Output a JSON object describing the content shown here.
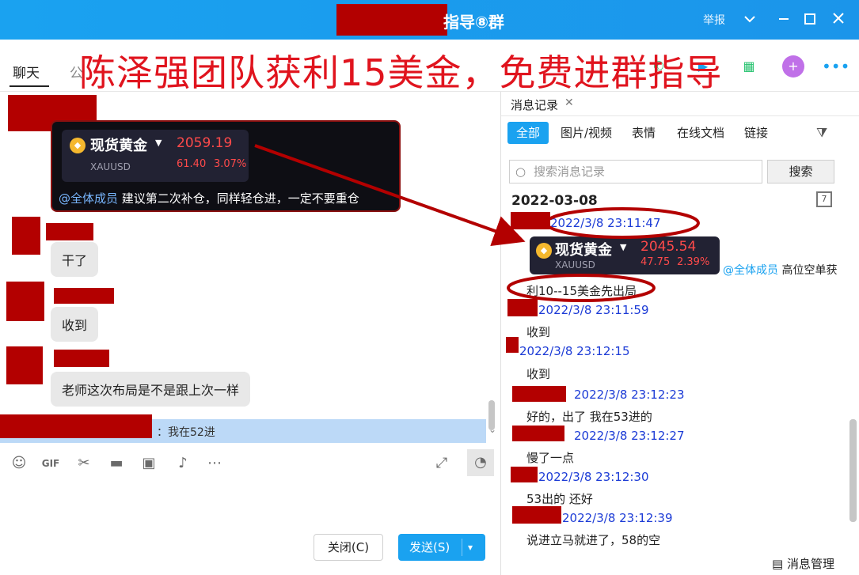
{
  "window": {
    "title": "指导⑧群",
    "report": "举报"
  },
  "banner": "陈泽强团队获利15美金，免费进群指导",
  "tabs": [
    {
      "label": "聊天"
    },
    {
      "label": "公"
    }
  ],
  "chat": {
    "quote": {
      "name": "现货黄金",
      "price": "2059.19",
      "code": "XAUUSD",
      "change": "61.40",
      "change_pct": "3.07%"
    },
    "announcement_mention": "@全体成员",
    "announcement_text": " 建议第二次补仓，同样轻仓进，一定不要重仓",
    "messages": [
      {
        "text": "干了"
      },
      {
        "text": "收到"
      },
      {
        "text": "老师这次布局是不是跟上次一样"
      }
    ],
    "reply_text": "：我在52进"
  },
  "buttons": {
    "close": "关闭(C)",
    "send": "发送(S)"
  },
  "panel": {
    "tab_title": "消息记录",
    "filters": [
      "全部",
      "图片/视频",
      "表情",
      "在线文档",
      "链接"
    ],
    "search_placeholder": "搜索消息记录",
    "search_button": "搜索",
    "date": "2022-03-08",
    "quote": {
      "name": "现货黄金",
      "price": "2045.54",
      "code": "XAUUSD",
      "change": "47.75",
      "change_pct": "2.39%"
    },
    "quote_mention": "@全体成员",
    "quote_text": " 高位空单获",
    "records": [
      {
        "time": "2022/3/8 23:11:47",
        "text": "利10--15美金先出局"
      },
      {
        "time": "2022/3/8 23:11:59",
        "text": "收到"
      },
      {
        "time": "2022/3/8 23:12:15",
        "text": "收到"
      },
      {
        "time": "2022/3/8 23:12:23",
        "text": "好的，出了 我在53进的"
      },
      {
        "time": "2022/3/8 23:12:27",
        "text": "慢了一点"
      },
      {
        "time": "2022/3/8 23:12:30",
        "text": "53出的  还好"
      },
      {
        "time": "2022/3/8 23:12:39",
        "text": "说进立马就进了，58的空"
      }
    ],
    "footer": "消息管理"
  }
}
